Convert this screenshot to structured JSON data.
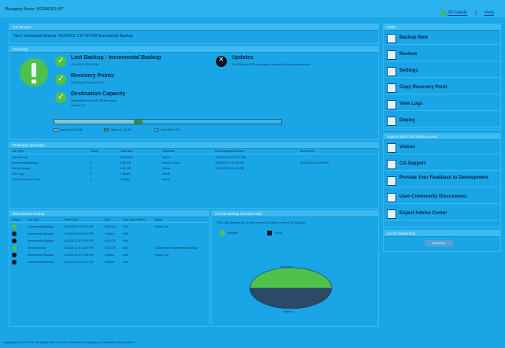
{
  "header": {
    "managing_server": "Managing Server: RGRAPES-W7",
    "rss_link": "All Feeds",
    "help_link": "Help"
  },
  "job_monitor": {
    "title": "Job Monitor",
    "next_backup": "Next Scheduled Backup: 4/14/2011 3:57:50 PM Incremental Backup"
  },
  "summary": {
    "title": "Summary",
    "last_backup_title": "Last Backup - Incremental Backup",
    "last_backup_time": "4/14/2011 7:57:54 AM",
    "recovery_points_title": "Recovery Points",
    "recovery_points_text": "4 Recovery Points out of 7",
    "destination_title": "Destination Capacity",
    "destination_text": "Destination has 66.82 GB free space",
    "destination_volume": "Volume: e:\\",
    "updates_title": "Updates",
    "updates_text": "CA ARCserve D2D is unable to connect to the download server",
    "capacity": {
      "backup_fraction": 0.35,
      "others_fraction": 0.04
    },
    "legend": {
      "backup": "Backup 33.58 GB",
      "others": "Others 11.41 GB",
      "free": "Free 66.82 GB"
    }
  },
  "protection_summary": {
    "title": "Protection Summary",
    "columns": [
      "Job Type",
      "Count",
      "Total Size",
      "Schedule",
      "Last Successful Event",
      "Next Event"
    ],
    "rows": [
      [
        "Full Backup",
        "1",
        "22.66 GB",
        "Never",
        "4/13/2011 12:57:00 PM",
        ""
      ],
      [
        "Incremental Backup",
        "2",
        "3.60 GB",
        "Every 1 Hour",
        "4/14/2011 7:57:54 AM",
        "4/14/2011 3:57:50 PM"
      ],
      [
        "Verify Backup",
        "1",
        "6.31 GB",
        "Never",
        "4/13/2011 5:18:22 PM",
        ""
      ],
      [
        "File Copy",
        "0",
        "0 Bytes",
        "Never",
        "",
        ""
      ],
      [
        "Copy Recovery Point",
        "0",
        "0 Bytes",
        "Never",
        "",
        ""
      ]
    ]
  },
  "recent_events": {
    "title": "Most Recent Events",
    "columns": [
      "Status",
      "Job Type",
      "Date/Time",
      "Size",
      "File Copy Status",
      "Name"
    ],
    "rows": [
      {
        "status": "ok",
        "cells": [
          "Incremental Backup",
          "4/14/2011 7:57:54 AM",
          "2.58 GB",
          "N/A",
          "Hourly Job"
        ]
      },
      {
        "status": "err",
        "cells": [
          "Incremental Backup",
          "4/13/2011 2:07:04 PM",
          "0 Bytes",
          "N/A",
          ""
        ]
      },
      {
        "status": "err",
        "cells": [
          "Incremental Backup",
          "4/13/2011 3:07:04 PM",
          "1.60 GB",
          "N/A",
          ""
        ]
      },
      {
        "status": "ok",
        "cells": [
          "Verify Backup",
          "4/13/2011 5:18:22 PM",
          "6.31 GB",
          "N/A",
          "Customized Incremental Backup"
        ]
      },
      {
        "status": "err",
        "cells": [
          "Incremental Backup",
          "4/13/2011 4:07:06 PM",
          "0 Bytes",
          "N/A",
          "Hourly Job"
        ]
      },
      {
        "status": "err",
        "cells": [
          "Incremental Backup",
          "4/13/2011 3:57:24 PM",
          "0 Bytes",
          "N/A",
          ""
        ]
      }
    ]
  },
  "success_rate": {
    "title": "Overall Backup Success Rate",
    "description": "This chart displays the overall success and failure rates of the backups",
    "legend_finished": "Finished",
    "legend_failed": "Failed",
    "finished_label": "Finished: 2",
    "failed_label": "Failed: 4",
    "finished_color": "#4fc14a",
    "failed_color": "#2b4a66"
  },
  "tasks": {
    "title": "Tasks",
    "items": [
      {
        "label": "Backup Now",
        "icon": "backup-now-icon"
      },
      {
        "label": "Restore",
        "icon": "restore-icon"
      },
      {
        "label": "Settings",
        "icon": "settings-icon"
      },
      {
        "label": "Copy Recovery Point",
        "icon": "copy-recovery-point-icon"
      },
      {
        "label": "View Logs",
        "icon": "view-logs-icon"
      },
      {
        "label": "Deploy",
        "icon": "deploy-icon"
      }
    ]
  },
  "support": {
    "title": "Support and Community Access",
    "items": [
      {
        "label": "Videos",
        "icon": "videos-icon"
      },
      {
        "label": "CA Support",
        "icon": "ca-support-icon"
      },
      {
        "label": "Provide Your Feedback to Development",
        "icon": "feedback-icon"
      },
      {
        "label": "User-Community Discussions",
        "icon": "community-icon"
      },
      {
        "label": "Expert Advice Center",
        "icon": "expert-advice-icon"
      }
    ]
  },
  "social": {
    "title": "Social Networking",
    "facebook": "facebook"
  },
  "footer": {
    "copyright": "Copyright (c) 2011 CA. All rights reserved. No unauthorized copying or distribution is permitted."
  }
}
